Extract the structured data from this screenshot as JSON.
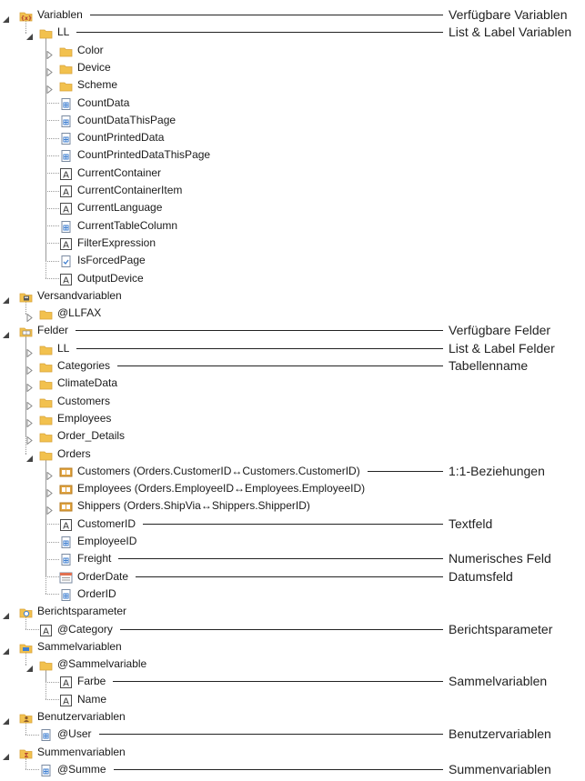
{
  "tree": [
    {
      "depth": 0,
      "exp": "open",
      "icon": "var-root-icon",
      "label": "Variablen",
      "callout": "Verfügbare Variablen"
    },
    {
      "depth": 1,
      "exp": "open",
      "icon": "folder-icon",
      "label": "LL",
      "callout": "List & Label Variablen"
    },
    {
      "depth": 2,
      "exp": "closed",
      "icon": "folder-icon",
      "label": "Color"
    },
    {
      "depth": 2,
      "exp": "closed",
      "icon": "folder-icon",
      "label": "Device"
    },
    {
      "depth": 2,
      "exp": "closed",
      "icon": "folder-icon",
      "label": "Scheme"
    },
    {
      "depth": 2,
      "exp": "none",
      "icon": "numeric-icon",
      "label": "CountData"
    },
    {
      "depth": 2,
      "exp": "none",
      "icon": "numeric-icon",
      "label": "CountDataThisPage"
    },
    {
      "depth": 2,
      "exp": "none",
      "icon": "numeric-icon",
      "label": "CountPrintedData"
    },
    {
      "depth": 2,
      "exp": "none",
      "icon": "numeric-icon",
      "label": "CountPrintedDataThisPage"
    },
    {
      "depth": 2,
      "exp": "none",
      "icon": "text-icon",
      "label": "CurrentContainer"
    },
    {
      "depth": 2,
      "exp": "none",
      "icon": "text-icon",
      "label": "CurrentContainerItem"
    },
    {
      "depth": 2,
      "exp": "none",
      "icon": "text-icon",
      "label": "CurrentLanguage"
    },
    {
      "depth": 2,
      "exp": "none",
      "icon": "numeric-icon",
      "label": "CurrentTableColumn"
    },
    {
      "depth": 2,
      "exp": "none",
      "icon": "text-icon",
      "label": "FilterExpression"
    },
    {
      "depth": 2,
      "exp": "none",
      "icon": "boolean-icon",
      "label": "IsForcedPage"
    },
    {
      "depth": 2,
      "exp": "none",
      "icon": "text-icon",
      "label": "OutputDevice"
    },
    {
      "depth": 0,
      "exp": "open",
      "icon": "versand-icon",
      "label": "Versandvariablen"
    },
    {
      "depth": 1,
      "exp": "closed",
      "icon": "folder-icon",
      "label": "@LLFAX"
    },
    {
      "depth": 0,
      "exp": "open",
      "icon": "fields-root-icon",
      "label": "Felder",
      "callout": "Verfügbare Felder"
    },
    {
      "depth": 1,
      "exp": "closed",
      "icon": "folder-icon",
      "label": "LL",
      "callout": "List & Label Felder"
    },
    {
      "depth": 1,
      "exp": "closed",
      "icon": "folder-icon",
      "label": "Categories",
      "callout": "Tabellenname"
    },
    {
      "depth": 1,
      "exp": "closed",
      "icon": "folder-icon",
      "label": "ClimateData"
    },
    {
      "depth": 1,
      "exp": "closed",
      "icon": "folder-icon",
      "label": "Customers"
    },
    {
      "depth": 1,
      "exp": "closed",
      "icon": "folder-icon",
      "label": "Employees"
    },
    {
      "depth": 1,
      "exp": "closed",
      "icon": "folder-icon",
      "label": "Order_Details"
    },
    {
      "depth": 1,
      "exp": "open",
      "icon": "folder-icon",
      "label": "Orders"
    },
    {
      "depth": 2,
      "exp": "closed",
      "icon": "relation-icon",
      "label": "Customers (Orders.CustomerID↔Customers.CustomerID)",
      "callout": "1:1-Beziehungen"
    },
    {
      "depth": 2,
      "exp": "closed",
      "icon": "relation-icon",
      "label": "Employees (Orders.EmployeeID↔Employees.EmployeeID)"
    },
    {
      "depth": 2,
      "exp": "closed",
      "icon": "relation-icon",
      "label": "Shippers (Orders.ShipVia↔Shippers.ShipperID)"
    },
    {
      "depth": 2,
      "exp": "none",
      "icon": "text-icon",
      "label": "CustomerID",
      "callout": "Textfeld"
    },
    {
      "depth": 2,
      "exp": "none",
      "icon": "numeric-icon",
      "label": "EmployeeID"
    },
    {
      "depth": 2,
      "exp": "none",
      "icon": "numeric-icon",
      "label": "Freight",
      "callout": "Numerisches Feld"
    },
    {
      "depth": 2,
      "exp": "none",
      "icon": "date-icon",
      "label": "OrderDate",
      "callout": "Datumsfeld"
    },
    {
      "depth": 2,
      "exp": "none",
      "icon": "numeric-icon",
      "label": "OrderID"
    },
    {
      "depth": 0,
      "exp": "open",
      "icon": "report-param-icon",
      "label": "Berichtsparameter"
    },
    {
      "depth": 1,
      "exp": "none",
      "icon": "text-icon",
      "label": "@Category",
      "callout": "Berichtsparameter"
    },
    {
      "depth": 0,
      "exp": "open",
      "icon": "collection-icon",
      "label": "Sammelvariablen"
    },
    {
      "depth": 1,
      "exp": "open",
      "icon": "folder-icon",
      "label": "@Sammelvariable"
    },
    {
      "depth": 2,
      "exp": "none",
      "icon": "text-icon",
      "label": "Farbe",
      "callout": "Sammelvariablen"
    },
    {
      "depth": 2,
      "exp": "none",
      "icon": "text-icon",
      "label": "Name"
    },
    {
      "depth": 0,
      "exp": "open",
      "icon": "user-var-icon",
      "label": "Benutzervariablen"
    },
    {
      "depth": 1,
      "exp": "none",
      "icon": "numeric-icon",
      "label": "@User",
      "callout": "Benutzervariablen"
    },
    {
      "depth": 0,
      "exp": "open",
      "icon": "sum-icon",
      "label": "Summenvariablen"
    },
    {
      "depth": 1,
      "exp": "none",
      "icon": "numeric-icon",
      "label": "@Summe",
      "callout": "Summenvariablen"
    }
  ],
  "colors": {
    "folder": "#f2c14e",
    "folder_dark": "#d9a43a",
    "line": "#222222",
    "icon_stroke": "#4a4a4a",
    "numeric_blue": "#3f7fd0",
    "relation_orange": "#e2a43f"
  }
}
